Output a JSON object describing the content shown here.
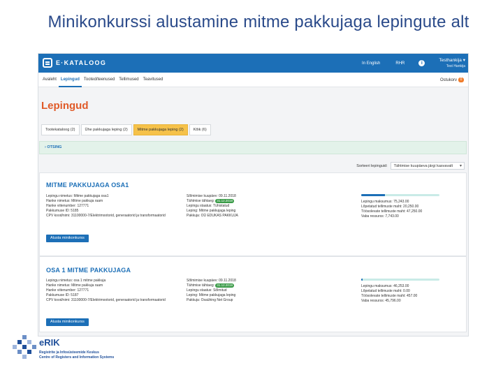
{
  "slide": {
    "title": "Minikonkurssi alustamine mitme pakkujaga lepingute alt"
  },
  "app": {
    "brand": "E·KATALOOG",
    "top_links": [
      "In English",
      "RHR"
    ],
    "user": {
      "name": "Testhankija",
      "sub": "Test Hankija"
    },
    "nav": {
      "items": [
        "Avaleht",
        "Lepingud",
        "Tooted/teenused",
        "Tellimused",
        "Teavitused"
      ],
      "active_index": 1
    },
    "cart": {
      "label": "Ostukorv",
      "count": "0"
    },
    "page_title": "Lepingud",
    "tabs": [
      "Tootekataloog (2)",
      "Ühe pakkujaga leping (2)",
      "Mitme pakkujaga leping (2)",
      "Kõik (6)"
    ],
    "active_tab": 2,
    "search_label": "› OTSING",
    "sort": {
      "label": "Sorteeri lepinguid:",
      "value": "Tähtmise kuupäeva järgi kasvavalt"
    },
    "cards": [
      {
        "title": "MITME PAKKUJAGA OSA1",
        "left": [
          "Lepingu nimetus: Mitme pakkujaga osa1",
          "Hanke nimetus:  Mitme pakkuja raam",
          "Hanke viitenumber:  127771",
          "Pakkumuse ID:  5185",
          "CPV kood/nimi: 31100000-7/Elektrimootorid, generaatorid ja transformaatorid"
        ],
        "mid": [
          "Sõlmimise kuupäev:  09.11.2018",
          "Tähtmise tähtaeg:",
          "Lepingu staatus:  Tühistatud",
          "Leping:  Mitme pakkujaga leping",
          "Pakkuja:  OÜ EDUKAS PAKKUJA"
        ],
        "status_date": "31.12.2019",
        "progress": 0.3,
        "right": [
          "Lepingu maksumus:  75,243.00",
          "Lõpetatud tellimuste maht:  20,250.00",
          "Töösolevate tellimuste maht:  47,250.00",
          "Vaba ressurss:  7,743.00"
        ],
        "button": "Alusta minikonkurss"
      },
      {
        "title": "OSA 1 MITME PAKKUJAGA",
        "left": [
          "Lepingu nimetus: osa 1 mitme pakkuja",
          "Hanke nimetus:  Mitme pakkuja raam",
          "Hanke viitenumber:  127771",
          "Pakkumuse ID:  5187",
          "CPV kood/nimi: 31100000-7/Elektrimootorid, generaatorid ja transformaatorid"
        ],
        "mid": [
          "Sõlmimise kuupäev:  09.11.2018",
          "Tähtmise tähtaeg:",
          "Lepingu staatus:  Sõlmitud",
          "Leping:  Mitme pakkujaga leping",
          "Pakkuja:  Osaühing Net Group"
        ],
        "status_date": "31.12.2019",
        "progress": 0.02,
        "right": [
          "Lepingu maksumus:  46,253.00",
          "Lõpetatud tellimuste maht:  0.00",
          "Töösolevate tellimuste maht:  457.00",
          "Vaba ressurss:  45,796.00"
        ],
        "button": "Alusta minikonkurss"
      }
    ]
  },
  "footer": {
    "logo_text": "eRIK",
    "org_line1": "Registrite ja Infosüsteemide Keskus",
    "org_line2": "Centre of Registers and Information Systems",
    "colors": {
      "brand_blue": "#1f4f9a",
      "accent_blue": "#1c6fb7",
      "accent_orange": "#e05a28"
    }
  }
}
